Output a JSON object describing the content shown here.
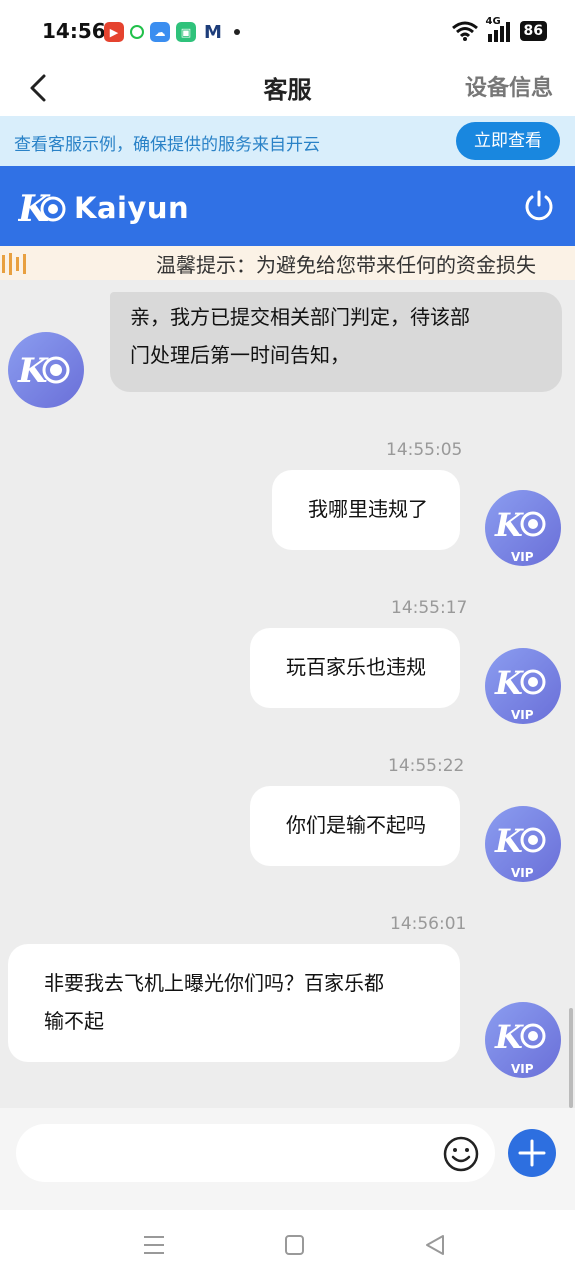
{
  "status_bar": {
    "time": "14:56",
    "network": "4G",
    "battery": "86"
  },
  "header": {
    "title": "客服",
    "right_action": "设备信息"
  },
  "notice": {
    "text": "查看客服示例，确保提供的服务来自开云",
    "button": "立即查看"
  },
  "brand": {
    "name": "Kaiyun",
    "accent": "#3071e5"
  },
  "marquee": {
    "text": "温馨提示：为避免给您带来任何的资金损失"
  },
  "messages": [
    {
      "from": "agent",
      "text_lines": [
        "亲，我方已提交相关部门判定，待该部",
        "门处理后第一时间告知，"
      ]
    },
    {
      "from": "user",
      "time": "14:55:05",
      "text": "我哪里违规了",
      "badge": "VIP"
    },
    {
      "from": "user",
      "time": "14:55:17",
      "text": "玩百家乐也违规",
      "badge": "VIP"
    },
    {
      "from": "user",
      "time": "14:55:22",
      "text": "你们是输不起吗",
      "badge": "VIP"
    },
    {
      "from": "user",
      "time": "14:56:01",
      "text_lines": [
        "非要我去飞机上曝光你们吗？百家乐都",
        "输不起"
      ],
      "badge": "VIP"
    }
  ],
  "input": {
    "placeholder": ""
  }
}
